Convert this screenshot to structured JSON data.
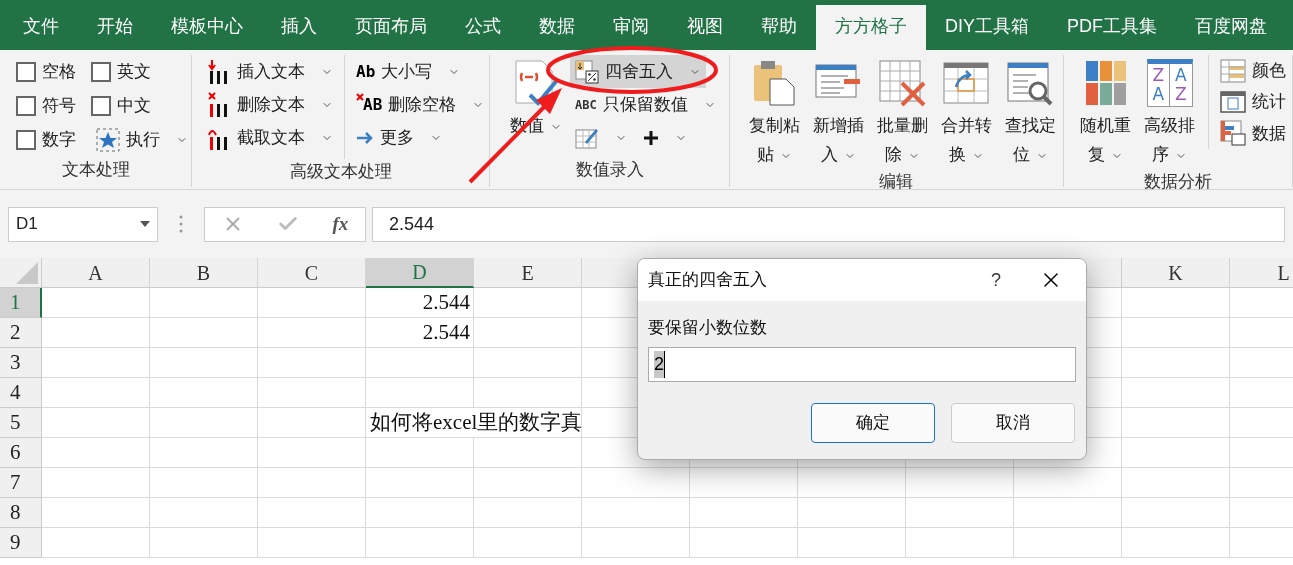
{
  "tabs": [
    {
      "label": "文件",
      "selected": false
    },
    {
      "label": "开始",
      "selected": false
    },
    {
      "label": "模板中心",
      "selected": false
    },
    {
      "label": "插入",
      "selected": false
    },
    {
      "label": "页面布局",
      "selected": false
    },
    {
      "label": "公式",
      "selected": false
    },
    {
      "label": "数据",
      "selected": false
    },
    {
      "label": "审阅",
      "selected": false
    },
    {
      "label": "视图",
      "selected": false
    },
    {
      "label": "帮助",
      "selected": false
    },
    {
      "label": "方方格子",
      "selected": true
    },
    {
      "label": "DIY工具箱",
      "selected": false
    },
    {
      "label": "PDF工具集",
      "selected": false
    },
    {
      "label": "百度网盘",
      "selected": false
    }
  ],
  "ribbon": {
    "groups": [
      {
        "label": "文本处理",
        "items": [
          {
            "kind": "checkbox",
            "label": "空格",
            "checked": false
          },
          {
            "kind": "checkbox",
            "label": "英文",
            "checked": false
          },
          {
            "kind": "checkbox",
            "label": "符号",
            "checked": false
          },
          {
            "kind": "checkbox",
            "label": "中文",
            "checked": false
          },
          {
            "kind": "checkbox",
            "label": "数字",
            "checked": false
          },
          {
            "kind": "small",
            "label": "执行",
            "dropdown": true,
            "highlighted": false
          }
        ]
      },
      {
        "label": "高级文本处理",
        "items": [
          {
            "kind": "small",
            "label": "插入文本",
            "dropdown": true,
            "highlighted": false
          },
          {
            "kind": "small",
            "label": "删除文本",
            "dropdown": true,
            "highlighted": false
          },
          {
            "kind": "small",
            "label": "截取文本",
            "dropdown": true,
            "highlighted": false
          },
          {
            "kind": "small",
            "icon_text": "Ab",
            "label": "大小写",
            "dropdown": true,
            "highlighted": false
          },
          {
            "kind": "small",
            "icon_text": "AB",
            "label": "删除空格",
            "dropdown": true,
            "highlighted": false
          },
          {
            "kind": "small",
            "label": "更多",
            "dropdown": true,
            "highlighted": false
          }
        ]
      },
      {
        "label": "数值录入",
        "items": [
          {
            "kind": "large",
            "label": "数值",
            "dropdown": true
          },
          {
            "kind": "small",
            "label": "四舍五入",
            "dropdown": true,
            "highlighted": true
          },
          {
            "kind": "small",
            "icon_text": "ABC",
            "label": "只保留数值",
            "dropdown": true,
            "highlighted": false
          },
          {
            "kind": "small",
            "dropdown": true,
            "highlighted": false
          },
          {
            "kind": "small",
            "dropdown": true,
            "highlighted": false
          }
        ]
      },
      {
        "label": "编辑",
        "items": [
          {
            "kind": "large",
            "label": "复制粘贴",
            "dropdown": true
          },
          {
            "kind": "large",
            "label": "新增插入",
            "dropdown": true
          },
          {
            "kind": "large",
            "label": "批量删除",
            "dropdown": true
          },
          {
            "kind": "large",
            "label": "合并转换",
            "dropdown": true
          },
          {
            "kind": "large",
            "label": "查找定位",
            "dropdown": true
          }
        ]
      },
      {
        "label": "数据分析",
        "items": [
          {
            "kind": "large",
            "label": "随机重复",
            "dropdown": true
          },
          {
            "kind": "large",
            "icon_text": [
              "ZA",
              "AZ"
            ],
            "label": "高级排序",
            "dropdown": true
          },
          {
            "kind": "small",
            "label": "颜色",
            "dropdown": false,
            "highlighted": false
          },
          {
            "kind": "small",
            "label": "统计",
            "dropdown": false,
            "highlighted": false
          },
          {
            "kind": "small",
            "label": "数据",
            "dropdown": false,
            "highlighted": false
          }
        ]
      }
    ]
  },
  "formula_bar": {
    "name_box": "D1",
    "fx": "fx",
    "value": "2.544"
  },
  "sheet": {
    "columns_left": [
      {
        "label": "A",
        "selected": false
      },
      {
        "label": "B",
        "selected": false
      },
      {
        "label": "C",
        "selected": false
      },
      {
        "label": "D",
        "selected": true
      },
      {
        "label": "E",
        "selected": false
      }
    ],
    "columns_right": [
      {
        "label": "K",
        "selected": false
      },
      {
        "label": "L",
        "selected": false
      }
    ],
    "rows": [
      {
        "label": "1",
        "selected": true,
        "col_d": "2.544"
      },
      {
        "label": "2",
        "selected": false,
        "col_d": "2.544"
      },
      {
        "label": "3",
        "selected": false
      },
      {
        "label": "4",
        "selected": false
      },
      {
        "label": "5",
        "selected": false,
        "col_d": "如何将excel里的数字真"
      },
      {
        "label": "6",
        "selected": false
      },
      {
        "label": "7",
        "selected": false
      },
      {
        "label": "8",
        "selected": false
      },
      {
        "label": "9",
        "selected": false
      }
    ]
  },
  "dialog": {
    "title": "真正的四舍五入",
    "help": "?",
    "label": "要保留小数位数",
    "value": "2",
    "buttons": [
      {
        "label": "确定",
        "default": true
      },
      {
        "label": "取消",
        "default": false
      }
    ]
  }
}
